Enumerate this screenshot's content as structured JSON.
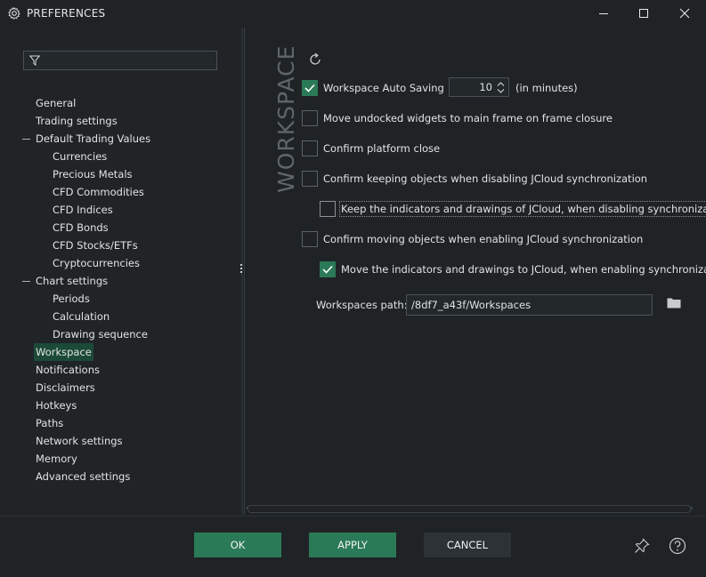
{
  "window": {
    "title": "PREFERENCES",
    "icon": "gear-icon"
  },
  "search": {
    "value": "",
    "icon": "filter-icon"
  },
  "tree": [
    {
      "label": "General",
      "level": 0
    },
    {
      "label": "Trading settings",
      "level": 0
    },
    {
      "label": "Default Trading Values",
      "level": 0,
      "expanded": true
    },
    {
      "label": "Currencies",
      "level": 1
    },
    {
      "label": "Precious Metals",
      "level": 1
    },
    {
      "label": "CFD Commodities",
      "level": 1
    },
    {
      "label": "CFD Indices",
      "level": 1
    },
    {
      "label": "CFD Bonds",
      "level": 1
    },
    {
      "label": "CFD Stocks/ETFs",
      "level": 1
    },
    {
      "label": "Cryptocurrencies",
      "level": 1
    },
    {
      "label": "Chart settings",
      "level": 0,
      "expanded": true
    },
    {
      "label": "Periods",
      "level": 1
    },
    {
      "label": "Calculation",
      "level": 1
    },
    {
      "label": "Drawing sequence",
      "level": 1
    },
    {
      "label": "Workspace",
      "level": 0,
      "selected": true
    },
    {
      "label": "Notifications",
      "level": 0
    },
    {
      "label": "Disclaimers",
      "level": 0
    },
    {
      "label": "Hotkeys",
      "level": 0
    },
    {
      "label": "Paths",
      "level": 0
    },
    {
      "label": "Network settings",
      "level": 0
    },
    {
      "label": "Memory",
      "level": 0
    },
    {
      "label": "Advanced settings",
      "level": 0
    }
  ],
  "section": {
    "title": "WORKSPACE",
    "auto_saving": {
      "label": "Workspace Auto Saving",
      "checked": true,
      "minutes": "10",
      "unit": "(in minutes)"
    },
    "options": [
      {
        "label": "Move undocked widgets to main frame on frame closure",
        "checked": false
      },
      {
        "label": "Confirm platform close",
        "checked": false
      },
      {
        "label": "Confirm keeping objects when disabling JCloud synchronization",
        "checked": false
      },
      {
        "label": "Keep the indicators and drawings of JCloud, when disabling synchronization",
        "checked": false,
        "indent": true,
        "focused": true
      },
      {
        "label": "Confirm moving objects when enabling JCloud synchronization",
        "checked": false
      },
      {
        "label": "Move the indicators and drawings to JCloud, when enabling synchronization",
        "checked": true,
        "indent": true
      }
    ],
    "path": {
      "label": "Workspaces path:",
      "value": "/8df7_a43f/Workspaces"
    }
  },
  "footer": {
    "ok": "OK",
    "apply": "APPLY",
    "cancel": "CANCEL"
  },
  "colors": {
    "accent": "#2b7a57",
    "background": "#1f2326",
    "selected": "#1b4a36"
  }
}
